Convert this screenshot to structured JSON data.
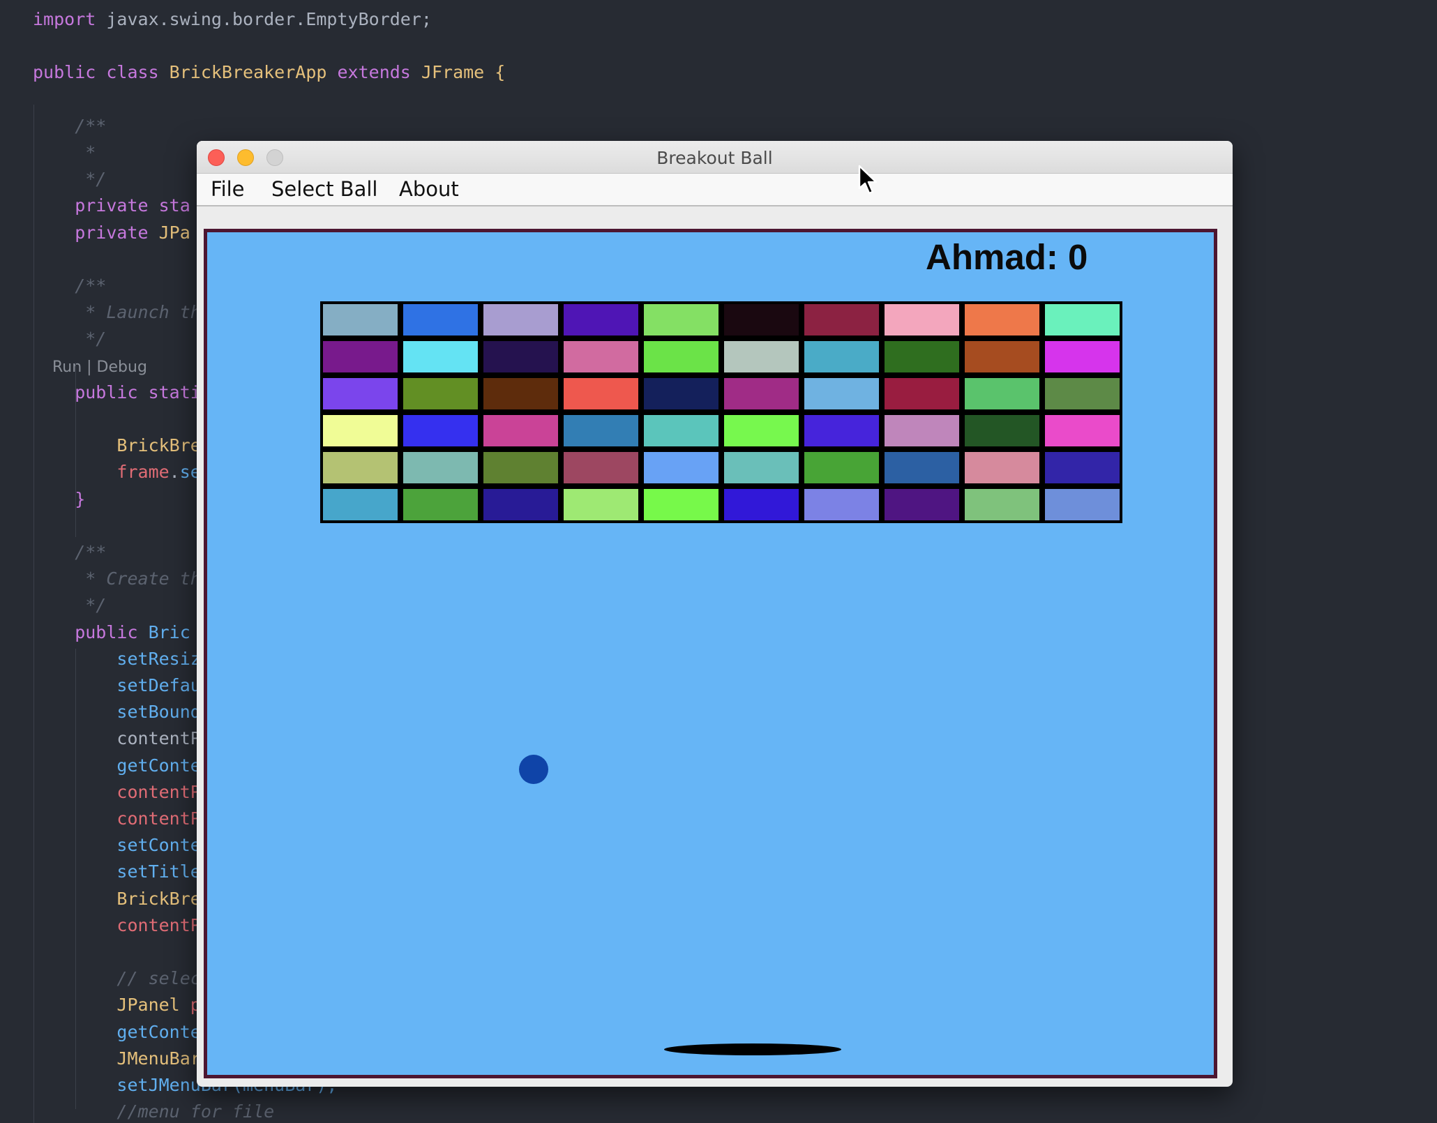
{
  "editor": {
    "lines": [
      [
        {
          "t": "import ",
          "c": "kw"
        },
        {
          "t": "javax.swing.border.EmptyBorder;",
          "c": "pl"
        }
      ],
      [],
      [
        {
          "t": "public ",
          "c": "kw"
        },
        {
          "t": "class ",
          "c": "kw"
        },
        {
          "t": "BrickBreakerApp ",
          "c": "ty"
        },
        {
          "t": "extends ",
          "c": "kw"
        },
        {
          "t": "JFrame ",
          "c": "ty"
        },
        {
          "t": "{",
          "c": "ty"
        }
      ],
      [],
      [
        {
          "t": "    /**",
          "c": "cm"
        }
      ],
      [
        {
          "t": "     *",
          "c": "cm"
        }
      ],
      [
        {
          "t": "     */",
          "c": "cm"
        }
      ],
      [
        {
          "t": "    private ",
          "c": "kw"
        },
        {
          "t": "sta",
          "c": "kw"
        }
      ],
      [
        {
          "t": "    private ",
          "c": "kw"
        },
        {
          "t": "JPa",
          "c": "ty"
        }
      ],
      [],
      [
        {
          "t": "    /**",
          "c": "cm"
        }
      ],
      [
        {
          "t": "     * Launch th",
          "c": "cm"
        }
      ],
      [
        {
          "t": "     */",
          "c": "cm"
        }
      ],
      [
        {
          "t": "    Run | Debug",
          "c": "lens"
        }
      ],
      [
        {
          "t": "    public ",
          "c": "kw"
        },
        {
          "t": "stati",
          "c": "kw"
        }
      ],
      [],
      [
        {
          "t": "        BrickBre",
          "c": "ty"
        }
      ],
      [
        {
          "t": "        frame",
          "c": "vr"
        },
        {
          "t": ".",
          "c": "pl"
        },
        {
          "t": "se",
          "c": "fn"
        }
      ],
      [
        {
          "t": "    }",
          "c": "kw"
        }
      ],
      [],
      [
        {
          "t": "    /**",
          "c": "cm"
        }
      ],
      [
        {
          "t": "     * Create th",
          "c": "cm"
        }
      ],
      [
        {
          "t": "     */",
          "c": "cm"
        }
      ],
      [
        {
          "t": "    public ",
          "c": "kw"
        },
        {
          "t": "Bric",
          "c": "fn"
        }
      ],
      [
        {
          "t": "        setResiz",
          "c": "fn"
        }
      ],
      [
        {
          "t": "        setDefau",
          "c": "fn"
        }
      ],
      [
        {
          "t": "        setBound",
          "c": "fn"
        }
      ],
      [
        {
          "t": "        contentP",
          "c": "pl"
        }
      ],
      [
        {
          "t": "        getConte",
          "c": "fn"
        }
      ],
      [
        {
          "t": "        contentP",
          "c": "vr"
        }
      ],
      [
        {
          "t": "        contentP",
          "c": "vr"
        }
      ],
      [
        {
          "t": "        setConte",
          "c": "fn"
        }
      ],
      [
        {
          "t": "        setTitle",
          "c": "fn"
        }
      ],
      [
        {
          "t": "        BrickBre",
          "c": "ty"
        }
      ],
      [
        {
          "t": "        contentP",
          "c": "vr"
        }
      ],
      [],
      [
        {
          "t": "        // selec",
          "c": "cm"
        }
      ],
      [
        {
          "t": "        JPanel ",
          "c": "ty"
        },
        {
          "t": "p",
          "c": "vr"
        }
      ],
      [
        {
          "t": "        getConte",
          "c": "fn"
        }
      ],
      [
        {
          "t": "        JMenuBar",
          "c": "ty"
        }
      ],
      [
        {
          "t": "        setJMenuBar(menuBar);",
          "c": "fn"
        }
      ],
      [
        {
          "t": "        //menu for file",
          "c": "cm"
        }
      ]
    ]
  },
  "window": {
    "title": "Breakout Ball",
    "menu": {
      "file": "File",
      "select_ball": "Select Ball",
      "about": "About"
    }
  },
  "game": {
    "score_text": "Ahmad: 0",
    "background": "#66b5f6",
    "border_color": "#4d1631",
    "ball_color": "#0f44a8",
    "paddle_color": "#000000",
    "bricks": [
      [
        "#85aec4",
        "#2f72e4",
        "#a89dd0",
        "#4f15b5",
        "#84e064",
        "#1a0810",
        "#8c2242",
        "#f3a6bd",
        "#ee784a",
        "#6af1bc"
      ],
      [
        "#781a8c",
        "#64e3f3",
        "#25124f",
        "#d16ba0",
        "#6be348",
        "#b4c6bd",
        "#4aabc7",
        "#2f6e1f",
        "#a64c20",
        "#d634ec"
      ],
      [
        "#7b45ec",
        "#628f24",
        "#5e2c0c",
        "#ee584e",
        "#14205b",
        "#a02c86",
        "#6fb2e1",
        "#991d40",
        "#5ac36c",
        "#5d8a47"
      ],
      [
        "#f0fc96",
        "#3530ef",
        "#ca4397",
        "#327eb4",
        "#5bc5bb",
        "#77f84e",
        "#4624db",
        "#bf86bb",
        "#235625",
        "#ea4bca"
      ],
      [
        "#b4c273",
        "#7db9b0",
        "#5f8131",
        "#9d4761",
        "#68a2f5",
        "#6abfb9",
        "#48a436",
        "#2c60a3",
        "#d68a9d",
        "#3225a8"
      ],
      [
        "#47a6cb",
        "#4ca33b",
        "#281b96",
        "#9ee973",
        "#77f94a",
        "#3118d8",
        "#7c82e5",
        "#4f1582",
        "#7fc27c",
        "#6e8fda"
      ]
    ]
  }
}
